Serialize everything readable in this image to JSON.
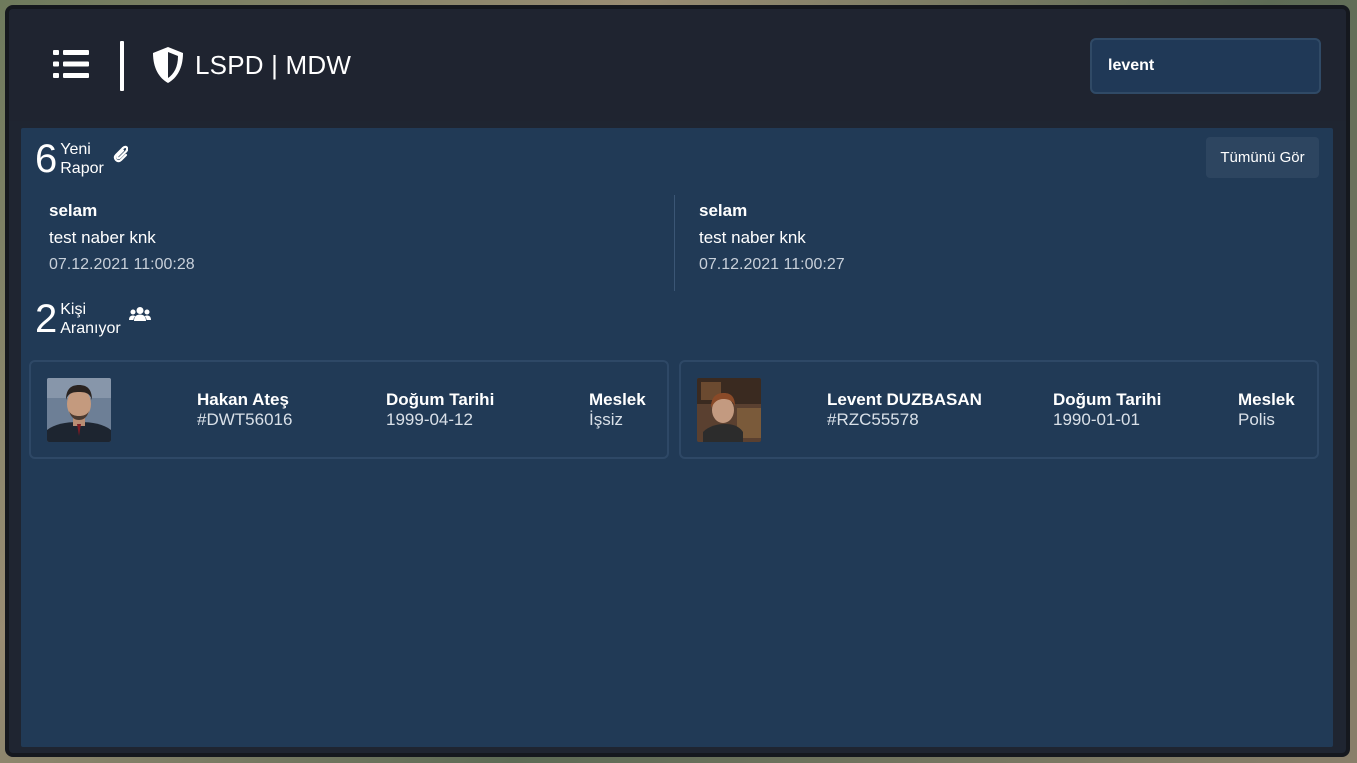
{
  "header": {
    "title": "LSPD | MDW",
    "search_value": "levent",
    "icons": {
      "menu": "list-icon",
      "brand": "shield-icon"
    }
  },
  "reports": {
    "count": "6",
    "label_line1": "Yeni",
    "label_line2": "Rapor",
    "icon": "paperclip-icon",
    "see_all_label": "Tümünü Gör",
    "items": [
      {
        "title": "selam",
        "body": "test naber knk",
        "date": "07.12.2021 11:00:28"
      },
      {
        "title": "selam",
        "body": "test naber knk",
        "date": "07.12.2021 11:00:27"
      }
    ]
  },
  "wanted": {
    "count": "2",
    "label_line1": "Kişi",
    "label_line2": "Aranıyor",
    "icon": "users-icon",
    "people": [
      {
        "name": "Hakan Ateş",
        "id": "#DWT56016",
        "dob_label": "Doğum Tarihi",
        "dob": "1999-04-12",
        "job_label": "Meslek",
        "job": "İşsiz"
      },
      {
        "name": "Levent DUZBASAN",
        "id": "#RZC55578",
        "dob_label": "Doğum Tarihi",
        "dob": "1990-01-01",
        "job_label": "Meslek",
        "job": "Polis"
      }
    ]
  },
  "colors": {
    "panel": "#213a56",
    "header": "#1f2430",
    "border": "#2e4866"
  }
}
